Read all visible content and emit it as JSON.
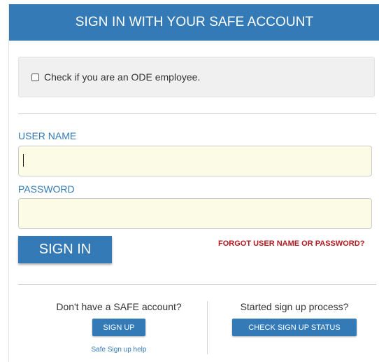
{
  "header": {
    "title": "SIGN IN WITH YOUR SAFE ACCOUNT"
  },
  "employee": {
    "label": "Check if you are an ODE employee."
  },
  "form": {
    "username_label": "USER NAME",
    "username_value": "",
    "password_label": "PASSWORD",
    "password_value": "",
    "signin_label": "SIGN IN",
    "forgot_label": "FORGOT USER NAME OR PASSWORD?"
  },
  "signup": {
    "prompt": "Don't have a SAFE account?",
    "button_label": "SIGN UP",
    "help_label": "Safe Sign up help"
  },
  "status": {
    "prompt": "Started sign up process?",
    "button_label": "CHECK SIGN UP STATUS"
  },
  "colors": {
    "primary": "#337ab7",
    "link_red": "#b3181f",
    "input_bg": "#fcfce6"
  }
}
